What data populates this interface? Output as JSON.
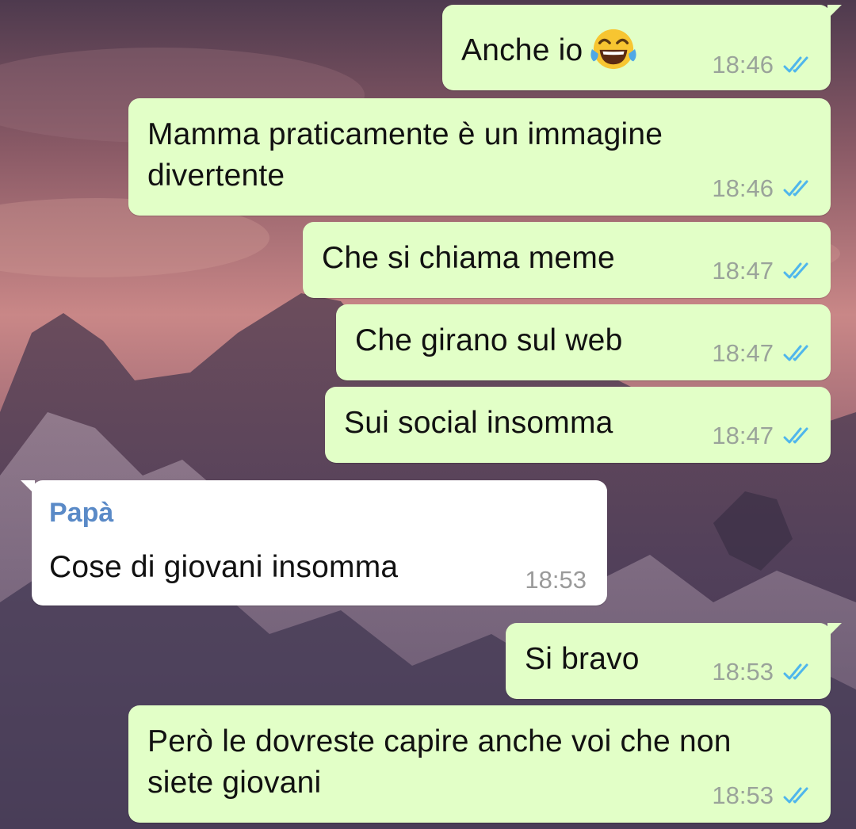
{
  "chat": {
    "messages": [
      {
        "id": "m1",
        "direction": "outgoing",
        "text": "Anche io",
        "emoji": "face-with-tears-of-joy",
        "time": "18:46",
        "status": "read"
      },
      {
        "id": "m2",
        "direction": "outgoing",
        "text": "Mamma praticamente è un immagine divertente",
        "time": "18:46",
        "status": "read"
      },
      {
        "id": "m3",
        "direction": "outgoing",
        "text": "Che si chiama meme",
        "time": "18:47",
        "status": "read"
      },
      {
        "id": "m4",
        "direction": "outgoing",
        "text": "Che girano sul web",
        "time": "18:47",
        "status": "read"
      },
      {
        "id": "m5",
        "direction": "outgoing",
        "text": "Sui social insomma",
        "time": "18:47",
        "status": "read"
      },
      {
        "id": "m6",
        "direction": "incoming",
        "sender": "Papà",
        "text": "Cose di giovani insomma",
        "time": "18:53"
      },
      {
        "id": "m7",
        "direction": "outgoing",
        "text": "Si bravo",
        "time": "18:53",
        "status": "read"
      },
      {
        "id": "m8",
        "direction": "outgoing",
        "text": "Però le dovreste capire anche voi che non siete giovani",
        "time": "18:53",
        "status": "read"
      }
    ]
  },
  "colors": {
    "outgoing_bubble": "#e2ffc7",
    "incoming_bubble": "#ffffff",
    "sender_name": "#5a8ac7",
    "read_ticks": "#4fb6ec"
  },
  "icons": {
    "read_status": "double-check-icon"
  }
}
